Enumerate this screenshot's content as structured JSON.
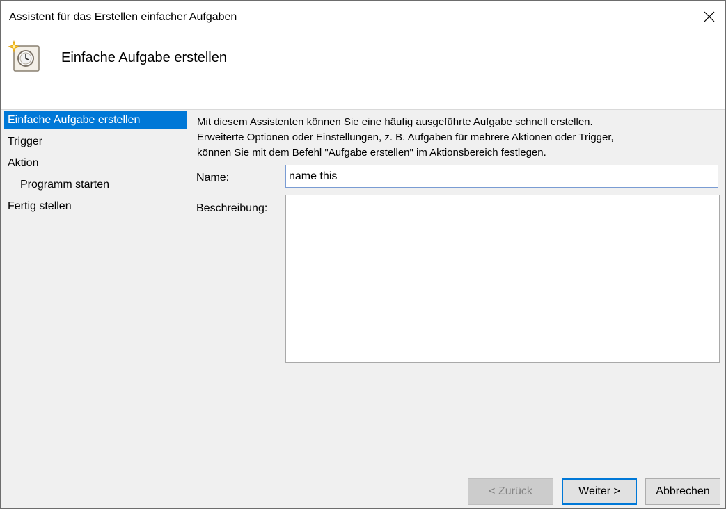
{
  "window": {
    "title": "Assistent für das Erstellen einfacher Aufgaben",
    "close_icon": "close-icon"
  },
  "header": {
    "icon": "task-scheduler-clock-icon",
    "title": "Einfache Aufgabe erstellen"
  },
  "nav": {
    "items": [
      {
        "label": "Einfache Aufgabe erstellen",
        "active": true
      },
      {
        "label": "Trigger",
        "active": false
      },
      {
        "label": "Aktion",
        "active": false
      },
      {
        "label": "Programm starten",
        "active": false,
        "sub": true
      },
      {
        "label": "Fertig stellen",
        "active": false
      }
    ]
  },
  "content": {
    "intro_lines": [
      "Mit diesem Assistenten können Sie eine häufig ausgeführte Aufgabe schnell erstellen.",
      "Erweiterte Optionen oder Einstellungen, z. B. Aufgaben für mehrere Aktionen oder Trigger,",
      "können Sie mit dem Befehl \"Aufgabe erstellen\" im Aktionsbereich festlegen."
    ],
    "name_label": "Name:",
    "name_value": "name this",
    "description_label": "Beschreibung:",
    "description_value": ""
  },
  "buttons": {
    "back": "< Zurück",
    "next": "Weiter >",
    "cancel": "Abbrechen"
  },
  "colors": {
    "accent": "#0078d7",
    "dialog_background": "#f0f0f0",
    "header_background": "#ffffff"
  }
}
